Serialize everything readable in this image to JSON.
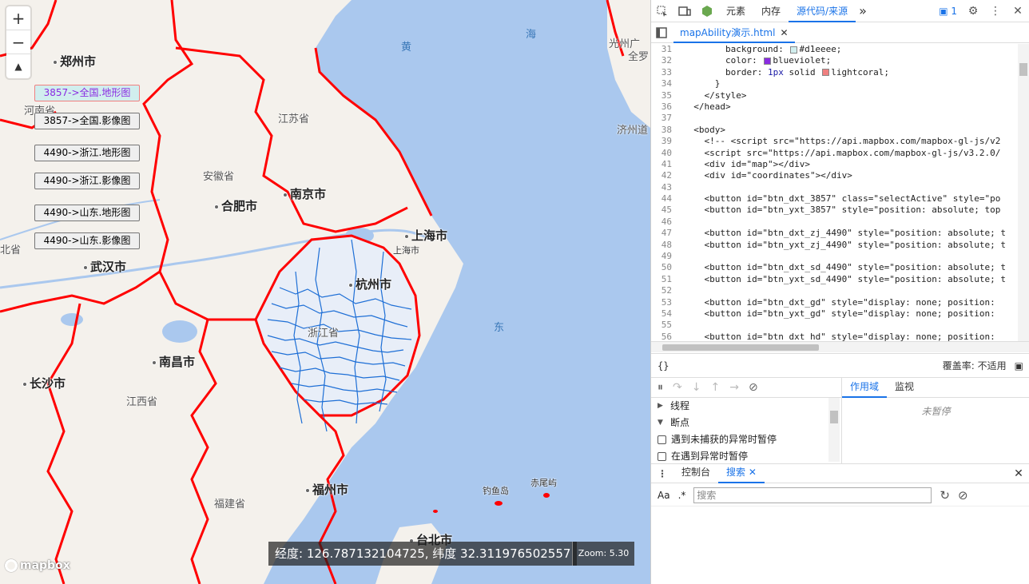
{
  "map": {
    "zoom_in": "+",
    "zoom_out": "−",
    "compass": "▲",
    "buttons": [
      {
        "label": "3857->全国.地形图",
        "active": true
      },
      {
        "label": "3857->全国.影像图",
        "active": false
      },
      {
        "label": "4490->浙江.地形图",
        "active": false
      },
      {
        "label": "4490->浙江.影像图",
        "active": false
      },
      {
        "label": "4490->山东.地形图",
        "active": false
      },
      {
        "label": "4490->山东.影像图",
        "active": false
      }
    ],
    "labels": {
      "zhengzhou": "郑州市",
      "henan": "河南省",
      "jiangsu": "江苏省",
      "anhui": "安徽省",
      "hefei": "合肥市",
      "nanjing": "南京市",
      "shanghai": "上海市",
      "shanghai2": "上海市",
      "hangzhou": "杭州市",
      "zhejiang": "浙江省",
      "wuhan": "武汉市",
      "hubei": "北省",
      "nanchang": "南昌市",
      "changsha": "长沙市",
      "jiangxi": "江西省",
      "fuzhou": "福州市",
      "fujian": "福建省",
      "taibei": "台北市",
      "diaoyu": "钓鱼岛",
      "chiwei": "赤尾屿",
      "guangzhou": "光州广",
      "quanluo": "全罗",
      "jizhou": "济州道",
      "sea_huang": "黄",
      "sea_hai": "海",
      "sea_dong": "东"
    },
    "coordinates": "经度: 126.787132104725, 纬度 32.311976502557",
    "zoom_label": "Zoom: 5.30",
    "logo": "mapbox",
    "colors": {
      "water": "#aac8ee",
      "land": "#f4f1ec",
      "border": "#ff0000",
      "zj_network": "#1e6fd6"
    }
  },
  "devtools": {
    "tabs": [
      "元素",
      "内存",
      "源代码/来源"
    ],
    "active_tab": "源代码/来源",
    "more": "»",
    "issues": "1",
    "file_tab": "mapAbility演示.html",
    "code": [
      {
        "n": "31",
        "html": "        background: <span class=\"swatch\" style=\"background:#d1eeee\"></span>#d1eeee;"
      },
      {
        "n": "32",
        "html": "        color: <span class=\"swatch\" style=\"background:#8a2be2\"></span>blueviolet;"
      },
      {
        "n": "33",
        "html": "        border: <span class=\"val\">1px</span> solid <span class=\"swatch\" style=\"background:#f08080\"></span>lightcoral;"
      },
      {
        "n": "34",
        "html": "      }"
      },
      {
        "n": "35",
        "html": "    &lt;/style&gt;"
      },
      {
        "n": "36",
        "html": "  &lt;/head&gt;"
      },
      {
        "n": "37",
        "html": ""
      },
      {
        "n": "38",
        "html": "  &lt;body&gt;"
      },
      {
        "n": "39",
        "html": "    &lt;!-- &lt;script src=\"https://api.mapbox.com/mapbox-gl-js/v2"
      },
      {
        "n": "40",
        "html": "    &lt;script src=\"https://api.mapbox.com/mapbox-gl-js/v3.2.0/"
      },
      {
        "n": "41",
        "html": "    &lt;div id=\"map\"&gt;&lt;/div&gt;"
      },
      {
        "n": "42",
        "html": "    &lt;div id=\"coordinates\"&gt;&lt;/div&gt;"
      },
      {
        "n": "43",
        "html": ""
      },
      {
        "n": "44",
        "html": "    &lt;button id=\"btn_dxt_3857\" class=\"selectActive\" style=\"po"
      },
      {
        "n": "45",
        "html": "    &lt;button id=\"btn_yxt_3857\" style=\"position: absolute; top"
      },
      {
        "n": "46",
        "html": ""
      },
      {
        "n": "47",
        "html": "    &lt;button id=\"btn_dxt_zj_4490\" style=\"position: absolute; t"
      },
      {
        "n": "48",
        "html": "    &lt;button id=\"btn_yxt_zj_4490\" style=\"position: absolute; t"
      },
      {
        "n": "49",
        "html": ""
      },
      {
        "n": "50",
        "html": "    &lt;button id=\"btn_dxt_sd_4490\" style=\"position: absolute; t"
      },
      {
        "n": "51",
        "html": "    &lt;button id=\"btn_yxt_sd_4490\" style=\"position: absolute; t"
      },
      {
        "n": "52",
        "html": ""
      },
      {
        "n": "53",
        "html": "    &lt;button id=\"btn_dxt_gd\" style=\"display: none; position: "
      },
      {
        "n": "54",
        "html": "    &lt;button id=\"btn_yxt_gd\" style=\"display: none; position: "
      },
      {
        "n": "55",
        "html": ""
      },
      {
        "n": "56",
        "html": "    &lt;button id=\"btn_dxt_hd\" style=\"display: none; position: "
      }
    ],
    "coverage": "覆盖率: 不适用",
    "scope_tabs": [
      "作用域",
      "监视"
    ],
    "scope_empty": "未暂停",
    "threads": "线程",
    "breakpoints": "断点",
    "pause_uncaught": "遇到未捕获的异常时暂停",
    "pause_caught": "在遇到异常时暂停",
    "drawer_tabs": [
      "控制台",
      "搜索"
    ],
    "search_case": "Aa",
    "search_regex": ".*",
    "search_placeholder": "搜索"
  }
}
